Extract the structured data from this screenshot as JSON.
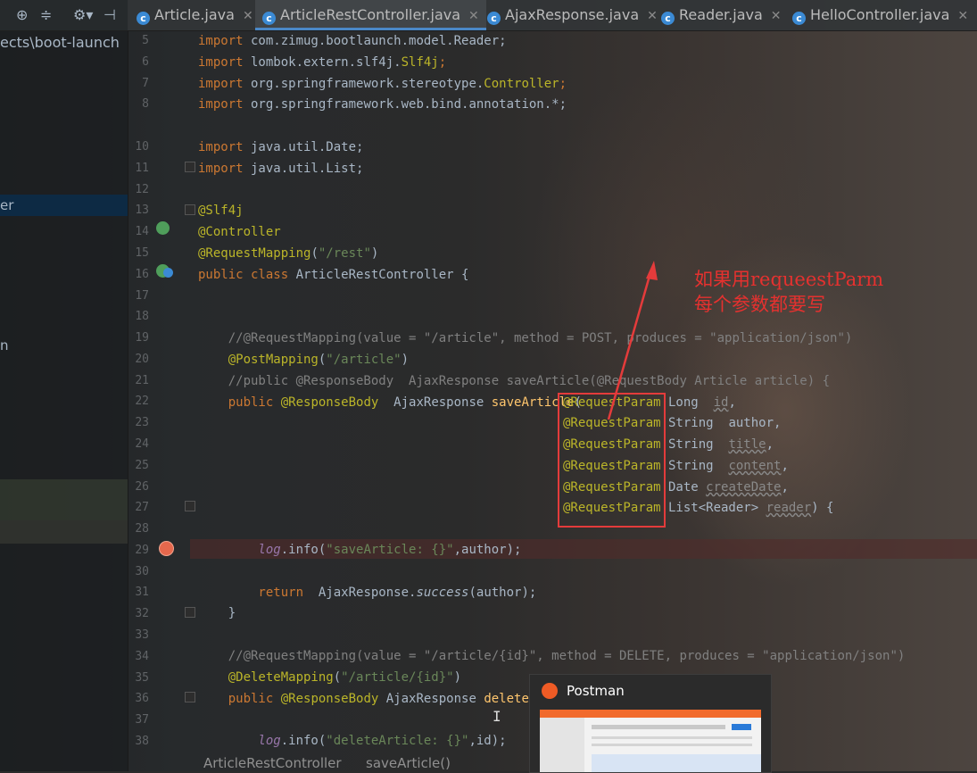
{
  "project": {
    "path_label": "ects\\boot-launch",
    "selected_item": "er",
    "item_n": "n"
  },
  "tabs": [
    {
      "label": "Article.java",
      "active": false
    },
    {
      "label": "ArticleRestController.java",
      "active": true
    },
    {
      "label": "AjaxResponse.java",
      "active": false
    },
    {
      "label": "Reader.java",
      "active": false
    },
    {
      "label": "HelloController.java",
      "active": false
    }
  ],
  "gutter_numbers": [
    "5",
    "6",
    "7",
    "8",
    "10",
    "11",
    "12",
    "13",
    "14",
    "15",
    "16",
    "17",
    "18",
    "19",
    "20",
    "21",
    "22",
    "23",
    "24",
    "25",
    "26",
    "27",
    "28",
    "29",
    "30",
    "31",
    "32",
    "33",
    "34",
    "35",
    "36",
    "37",
    "38"
  ],
  "code": {
    "l5_a": "import",
    "l5_b": " com.zimug.bootlaunch.model.Reader;",
    "l6_a": "import",
    "l6_b": " lombok.extern.slf4j.",
    "l6_c": "Slf4j",
    "l6_d": ";",
    "l7_a": "import",
    "l7_b": " org.springframework.stereotype.",
    "l7_c": "Controller",
    "l7_d": ";",
    "l8_a": "import",
    "l8_b": " org.springframework.web.bind.annotation.*;",
    "l10_a": "import",
    "l10_b": " java.util.Date;",
    "l11_a": "import",
    "l11_b": " java.util.List;",
    "l13": "@Slf4j",
    "l14": "@Controller",
    "l15_a": "@RequestMapping",
    "l15_b": "(",
    "l15_c": "\"/rest\"",
    "l15_d": ")",
    "l16_a": "public class",
    "l16_b": " ArticleRestController {",
    "l19": "    //@RequestMapping(value = \"/article\", method = POST, produces = \"application/json\")",
    "l20_a": "    @PostMapping",
    "l20_b": "(",
    "l20_c": "\"/article\"",
    "l20_d": ")",
    "l21": "    //public @ResponseBody  AjaxResponse saveArticle(@RequestBody Article article) {",
    "l22_a": "    public",
    "l22_b": " @ResponseBody",
    "l22_c": "  AjaxResponse ",
    "l22_d": "saveArticle",
    "l22_e": "(",
    "param_anno": "@RequestParam",
    "p1_type": " Long  ",
    "p1_name": "id",
    "p1_tail": ",",
    "p2_type": " String  ",
    "p2_name": "author",
    "p2_tail": ",",
    "p3_type": " String  ",
    "p3_name": "title",
    "p3_tail": ",",
    "p4_type": " String  ",
    "p4_name": "content",
    "p4_tail": ",",
    "p5_type": " Date ",
    "p5_name": "createDate",
    "p5_tail": ",",
    "p6_type": " List<Reader> ",
    "p6_name": "reader",
    "p6_tail": ") {",
    "l29_a": "        log",
    "l29_b": ".info(",
    "l29_c": "\"saveArticle: {}\"",
    "l29_d": ",author);",
    "l31_a": "        return",
    "l31_b": "  AjaxResponse.",
    "l31_c": "success",
    "l31_d": "(author);",
    "l32": "    }",
    "l34": "    //@RequestMapping(value = \"/article/{id}\", method = DELETE, produces = \"application/json\")",
    "l35_a": "    @DeleteMapping",
    "l35_b": "(",
    "l35_c": "\"/article/{id}\"",
    "l35_d": ")",
    "l36_a": "    public",
    "l36_b": " @ResponseBody",
    "l36_c": " AjaxResponse ",
    "l36_d": "deleteAr",
    "l38_a": "        log",
    "l38_b": ".info(",
    "l38_c": "\"deleteArticle: {}\"",
    "l38_d": ",id);"
  },
  "annotation": {
    "line1": "如果用requeestParm",
    "line2": "每个参数都要写",
    "color": "#e5312f"
  },
  "postman": {
    "title": "Postman"
  },
  "breadcrumb": {
    "class": "ArticleRestController",
    "method": "saveArticle()"
  },
  "colors": {
    "keyword": "#cc7832",
    "annotation": "#bbb529",
    "string": "#6a8759",
    "comment": "#808080",
    "function": "#ffc66d"
  }
}
